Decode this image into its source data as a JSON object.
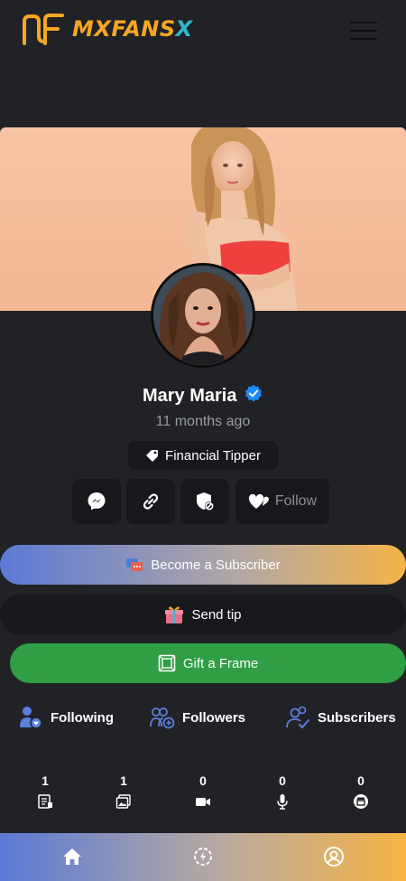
{
  "header": {
    "logo_part1": "MXFANS",
    "logo_part2": "X"
  },
  "profile": {
    "name": "Mary Maria",
    "joined": "11 months ago",
    "tag_label": "Financial Tipper",
    "verified": true
  },
  "actions": {
    "follow_label": "Follow"
  },
  "buttons": {
    "subscribe_label": "Become a Subscriber",
    "tip_label": "Send tip",
    "gift_label": "Gift a Frame"
  },
  "stats": {
    "following_label": "Following",
    "followers_label": "Followers",
    "subscribers_label": "Subscribers"
  },
  "counters": [
    {
      "value": "1",
      "icon": "posts-icon"
    },
    {
      "value": "1",
      "icon": "photos-icon"
    },
    {
      "value": "0",
      "icon": "videos-icon"
    },
    {
      "value": "0",
      "icon": "audio-icon"
    },
    {
      "value": "0",
      "icon": "shop-icon"
    }
  ],
  "colors": {
    "background": "#212226",
    "accent_orange": "#f5a623",
    "accent_teal": "#2fb7c9",
    "gift_green": "#2f9e45",
    "verified_blue": "#1d8cf2"
  }
}
